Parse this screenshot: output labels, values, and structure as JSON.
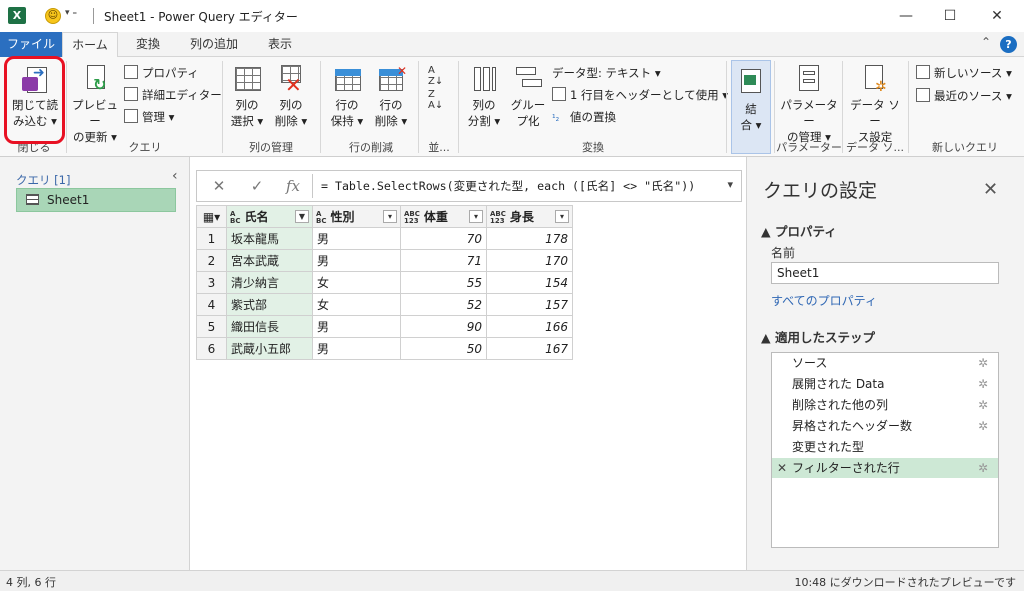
{
  "titlebar": {
    "title": "Sheet1 - Power Query エディター",
    "app_icon": "excel-icon",
    "minimize": "—",
    "maximize": "☐",
    "close": "✕"
  },
  "tabs": [
    "ファイル",
    "ホーム",
    "変換",
    "列の追加",
    "表示"
  ],
  "ribbon": {
    "close_load": {
      "line1": "閉じて読",
      "line2": "み込む ▾",
      "group": "閉じる"
    },
    "query": {
      "preview": {
        "line1": "プレビュー",
        "line2": "の更新 ▾"
      },
      "properties": "プロパティ",
      "advanced_editor": "詳細エディター",
      "manage": "管理 ▾",
      "group": "クエリ"
    },
    "columns": {
      "select": {
        "line1": "列の",
        "line2": "選択 ▾"
      },
      "remove": {
        "line1": "列の",
        "line2": "削除 ▾"
      },
      "group": "列の管理"
    },
    "rows": {
      "keep": {
        "line1": "行の",
        "line2": "保持 ▾"
      },
      "remove": {
        "line1": "行の",
        "line2": "削除 ▾"
      },
      "group": "行の削減"
    },
    "sort": {
      "group": "並..."
    },
    "transform": {
      "split": {
        "line1": "列の",
        "line2": "分割 ▾"
      },
      "group_by": {
        "line1": "グルー",
        "line2": "プ化"
      },
      "data_type": "データ型: テキスト ▾",
      "first_row": "1 行目をヘッダーとして使用 ▾",
      "replace": "値の置換",
      "group": "変換"
    },
    "merge": {
      "line1": "結",
      "line2": "合 ▾"
    },
    "params": {
      "line1": "パラメーター",
      "line2": "の管理 ▾",
      "group": "パラメーター"
    },
    "datasource": {
      "line1": "データ ソー",
      "line2": "ス設定",
      "group": "データ ソ..."
    },
    "newquery": {
      "new_source": "新しいソース ▾",
      "recent": "最近のソース ▾",
      "group": "新しいクエリ"
    }
  },
  "left_pane": {
    "header": "クエリ [1]",
    "item": "Sheet1"
  },
  "formula_bar": {
    "cancel": "✕",
    "confirm": "✓",
    "fx": "fx",
    "formula": "= Table.SelectRows(変更された型, each ([氏名] <> \"氏名\"))"
  },
  "table": {
    "columns": [
      {
        "type_top": "A",
        "type_bottom": "BC",
        "name": "氏名"
      },
      {
        "type_top": "A",
        "type_bottom": "BC",
        "name": "性別"
      },
      {
        "type_top": "ABC",
        "type_bottom": "123",
        "name": "体重"
      },
      {
        "type_top": "ABC",
        "type_bottom": "123",
        "name": "身長"
      }
    ],
    "rows": [
      [
        "1",
        "坂本龍馬",
        "男",
        "70",
        "178"
      ],
      [
        "2",
        "宮本武蔵",
        "男",
        "71",
        "170"
      ],
      [
        "3",
        "清少納言",
        "女",
        "55",
        "154"
      ],
      [
        "4",
        "紫式部",
        "女",
        "52",
        "157"
      ],
      [
        "5",
        "織田信長",
        "男",
        "90",
        "166"
      ],
      [
        "6",
        "武蔵小五郎",
        "男",
        "50",
        "167"
      ]
    ]
  },
  "right_pane": {
    "title": "クエリの設定",
    "properties_header": "▲ プロパティ",
    "name_label": "名前",
    "name_value": "Sheet1",
    "all_props_link": "すべてのプロパティ",
    "steps_header": "▲ 適用したステップ",
    "steps": [
      "ソース",
      "展開された Data",
      "削除された他の列",
      "昇格されたヘッダー数",
      "変更された型",
      "フィルターされた行"
    ]
  },
  "status": {
    "left": "4 列, 6 行",
    "right": "10:48 にダウンロードされたプレビューです"
  }
}
